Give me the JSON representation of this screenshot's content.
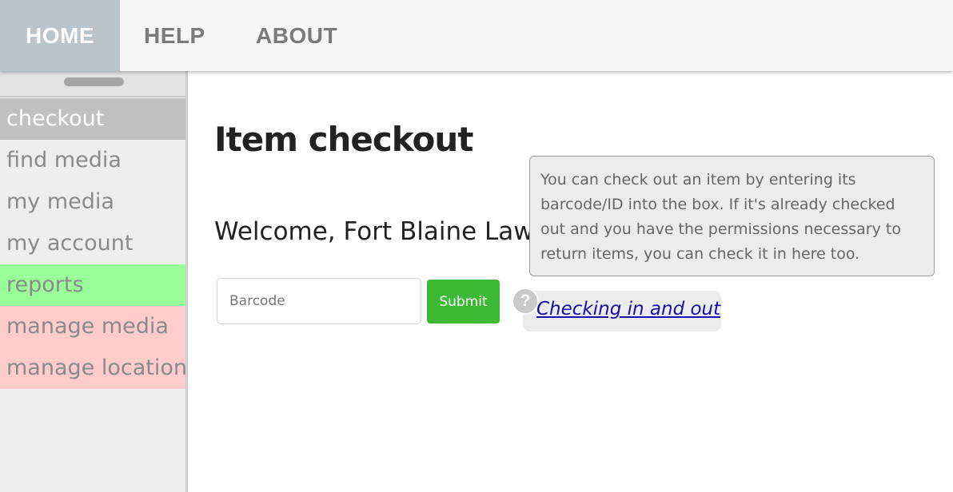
{
  "topnav": {
    "items": [
      {
        "label": "HOME",
        "active": true
      },
      {
        "label": "HELP",
        "active": false
      },
      {
        "label": "ABOUT",
        "active": false
      }
    ]
  },
  "sidebar": {
    "items": [
      {
        "label": "checkout",
        "state": "active"
      },
      {
        "label": "find media",
        "state": "normal"
      },
      {
        "label": "my media",
        "state": "normal"
      },
      {
        "label": "my account",
        "state": "normal"
      },
      {
        "label": "reports",
        "state": "highlight-green"
      },
      {
        "label": "manage media",
        "state": "highlight-red"
      },
      {
        "label": "manage location",
        "state": "highlight-red"
      }
    ]
  },
  "main": {
    "title": "Item checkout",
    "welcome": "Welcome, Fort Blaine Law",
    "form": {
      "barcode_placeholder": "Barcode",
      "barcode_value": "",
      "submit_label": "Submit"
    },
    "help": {
      "icon_glyph": "?",
      "link_label": "Checking in and out",
      "tooltip": "You can check out an item by entering its barcode/ID into the box. If it's already checked out and you have the permissions necessary to return items, you can check it in here too."
    }
  },
  "colors": {
    "home_active_bg": "#b9c4cb",
    "submit_green": "#3cb935",
    "reports_green": "#99ff99",
    "manage_red": "#ffcccc",
    "link_blue": "#1a0dab"
  },
  "icons": {
    "help": "help-question-icon",
    "drawer": "drawer-handle-icon"
  }
}
